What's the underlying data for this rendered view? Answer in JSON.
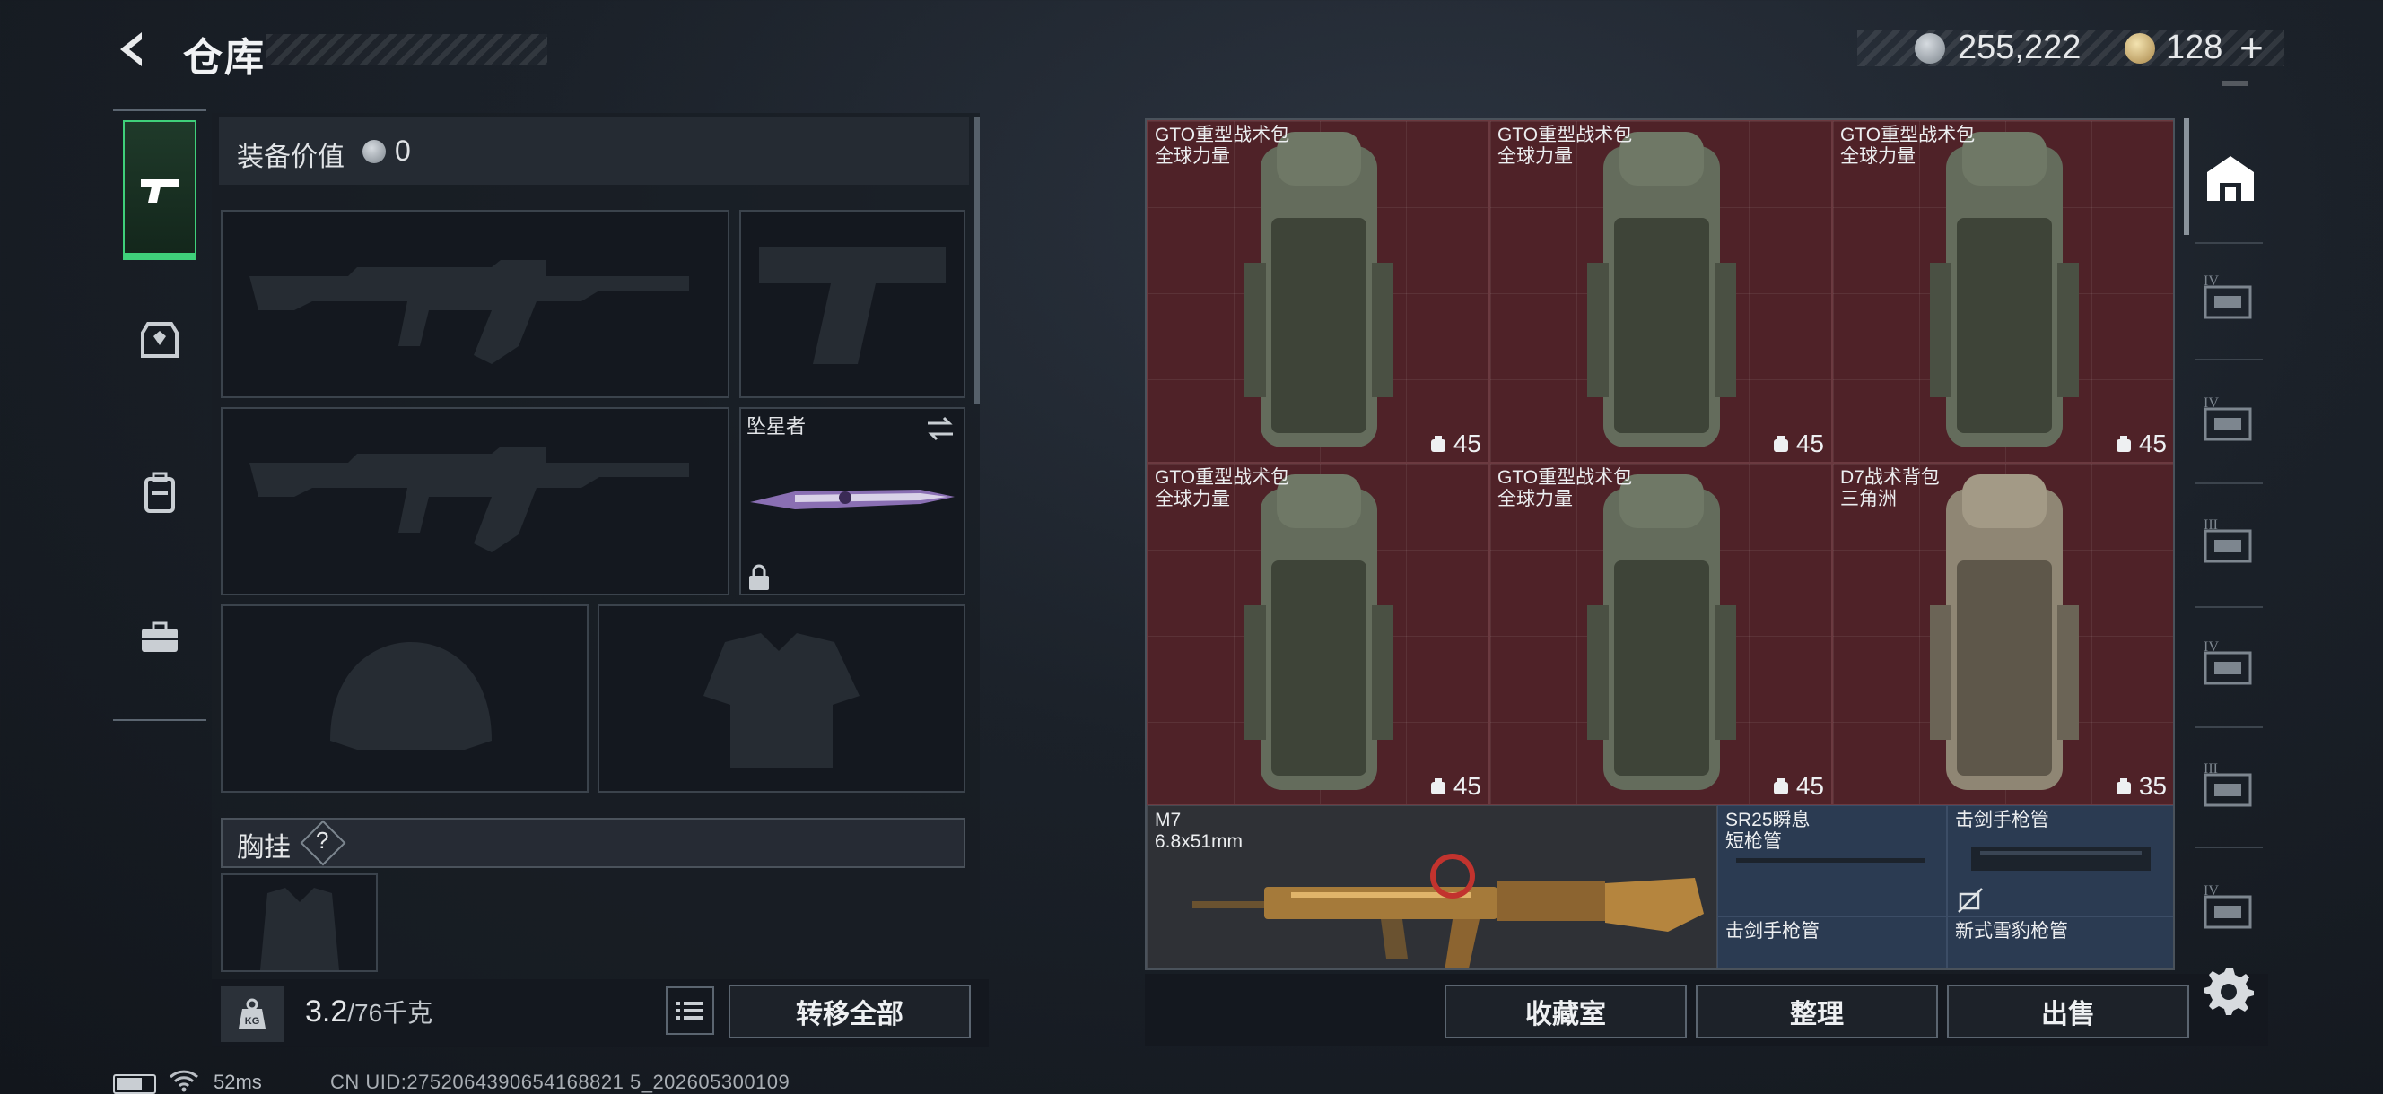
{
  "header": {
    "title": "仓库",
    "silver_amount": "255,222",
    "gold_amount": "128",
    "plus_label": "+"
  },
  "loadout": {
    "value_label": "装备价值",
    "value_amount": "0",
    "melee_name": "坠星者",
    "chest_label": "胸挂",
    "chest_help": "?",
    "weight_current": "3.2",
    "weight_max": "/76千克",
    "weight_badge": "KG",
    "transfer_all_label": "转移全部"
  },
  "storage": {
    "backpacks": [
      {
        "name": "GTO重型战术包",
        "sub": "全球力量",
        "capacity": "45",
        "tint": "#646c5c"
      },
      {
        "name": "GTO重型战术包",
        "sub": "全球力量",
        "capacity": "45",
        "tint": "#646c5c"
      },
      {
        "name": "GTO重型战术包",
        "sub": "全球力量",
        "capacity": "45",
        "tint": "#646c5c"
      },
      {
        "name": "GTO重型战术包",
        "sub": "全球力量",
        "capacity": "45",
        "tint": "#646c5c"
      },
      {
        "name": "GTO重型战术包",
        "sub": "全球力量",
        "capacity": "45",
        "tint": "#646c5c"
      },
      {
        "name": "D7战术背包",
        "sub": "三角洲",
        "capacity": "35",
        "tint": "#8f8674"
      }
    ],
    "weapon": {
      "name": "M7",
      "caliber": "6.8x51mm"
    },
    "parts": [
      {
        "name": "SR25瞬息",
        "sub": "短枪管"
      },
      {
        "name": "击剑手枪管",
        "sub": ""
      },
      {
        "name": "击剑手枪管",
        "sub": ""
      },
      {
        "name": "新式雪豹枪管",
        "sub": ""
      }
    ]
  },
  "buttons": {
    "collection": "收藏室",
    "sort": "整理",
    "sell": "出售"
  },
  "rail": {
    "tiers": [
      "IV",
      "IV",
      "III",
      "IV",
      "III",
      "IV"
    ]
  },
  "status": {
    "ping": "52ms",
    "uid": "CN UID:2752064390654168821 5_202605300109"
  },
  "colors": {
    "accent_green": "#3fd07a",
    "backpack_cell": "#4f2228",
    "part_cell": "#2b3b52"
  },
  "icons": {
    "back": "back-arrow-icon",
    "silver": "silver-coin-icon",
    "gold": "gold-coin-icon",
    "nav": [
      "pistol-icon",
      "armor-icon",
      "backpack-icon",
      "briefcase-icon"
    ],
    "settings": "gear-icon"
  }
}
